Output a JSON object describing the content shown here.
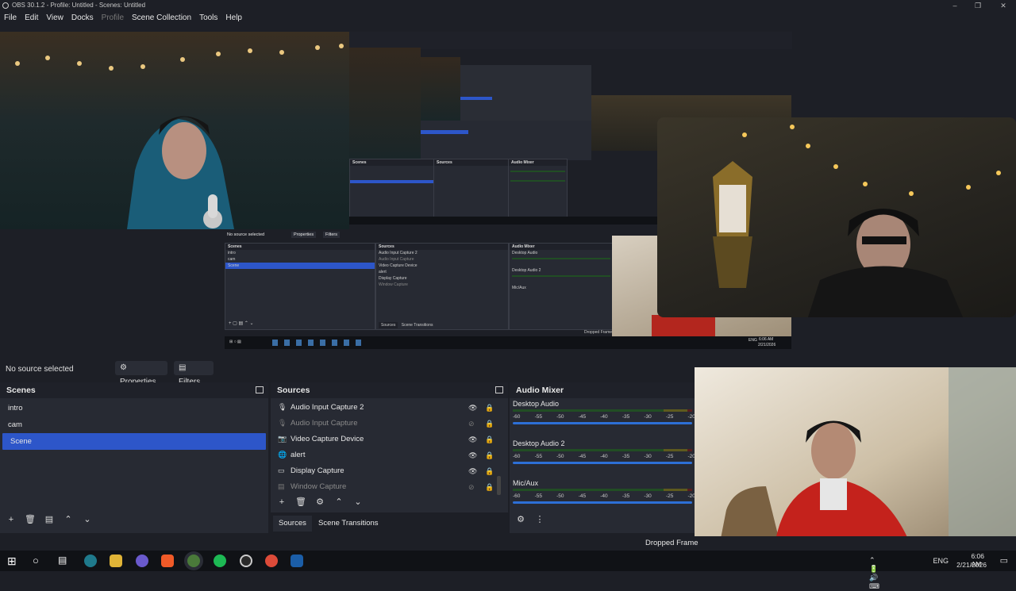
{
  "window": {
    "title": "OBS 30.1.2 - Profile: Untitled - Scenes: Untitled",
    "controls": [
      "–",
      "❐",
      "✕"
    ]
  },
  "menu": [
    "File",
    "Edit",
    "View",
    "Docks",
    "Profile",
    "Scene Collection",
    "Tools",
    "Help"
  ],
  "preview_nested": {
    "no_source": "No source selected",
    "properties": "Properties",
    "filters": "Filters",
    "scenes_title": "Scenes",
    "scenes": [
      "intro",
      "cam",
      "Scene"
    ],
    "sources_title": "Sources",
    "sources": [
      "Audio Input Capture 2",
      "Audio Input Capture",
      "Video Capture Device",
      "alert",
      "Display Capture",
      "Window Capture"
    ],
    "mixer_title": "Audio Mixer",
    "mixer_channels": [
      "Desktop Audio",
      "Desktop Audio 2",
      "Mic/Aux"
    ],
    "tab_sources": "Sources",
    "tab_transitions": "Scene Transitions",
    "dropped": "Dropped Frame",
    "tray_lang": "ENG",
    "tray_time": "6:06 AM",
    "tray_date": "2/21/2026"
  },
  "source_bar": {
    "no_source": "No source selected",
    "properties": "Properties",
    "filters": "Filters"
  },
  "scenes_dock": {
    "title": "Scenes",
    "items": [
      "intro",
      "cam",
      "Scene"
    ],
    "selected": "Scene"
  },
  "sources_dock": {
    "title": "Sources",
    "items": [
      {
        "label": "Audio Input Capture 2",
        "icon": "mic-icon",
        "visible": true
      },
      {
        "label": "Audio Input Capture",
        "icon": "mic-icon",
        "visible": false
      },
      {
        "label": "Video Capture Device",
        "icon": "camera-icon",
        "visible": true
      },
      {
        "label": "alert",
        "icon": "globe-icon",
        "visible": true
      },
      {
        "label": "Display Capture",
        "icon": "monitor-icon",
        "visible": true
      },
      {
        "label": "Window Capture",
        "icon": "window-icon",
        "visible": false
      }
    ],
    "tabs": [
      "Sources",
      "Scene Transitions"
    ]
  },
  "mixer_dock": {
    "title": "Audio Mixer",
    "channels": [
      "Desktop Audio",
      "Desktop Audio 2",
      "Mic/Aux"
    ],
    "ticks": [
      "-60",
      "-55",
      "-50",
      "-45",
      "-40",
      "-35",
      "-30",
      "-25",
      "-20"
    ]
  },
  "status": {
    "dropped": "Dropped Frame"
  },
  "tray": {
    "lang": "ENG",
    "time": "6:06 AM",
    "date": "2/21/2026"
  },
  "colors": {
    "background": "#1d1f26",
    "panel": "#272a33",
    "selection": "#2d56c9",
    "meter_green": "#214d24",
    "fader": "#2d6fd6"
  }
}
